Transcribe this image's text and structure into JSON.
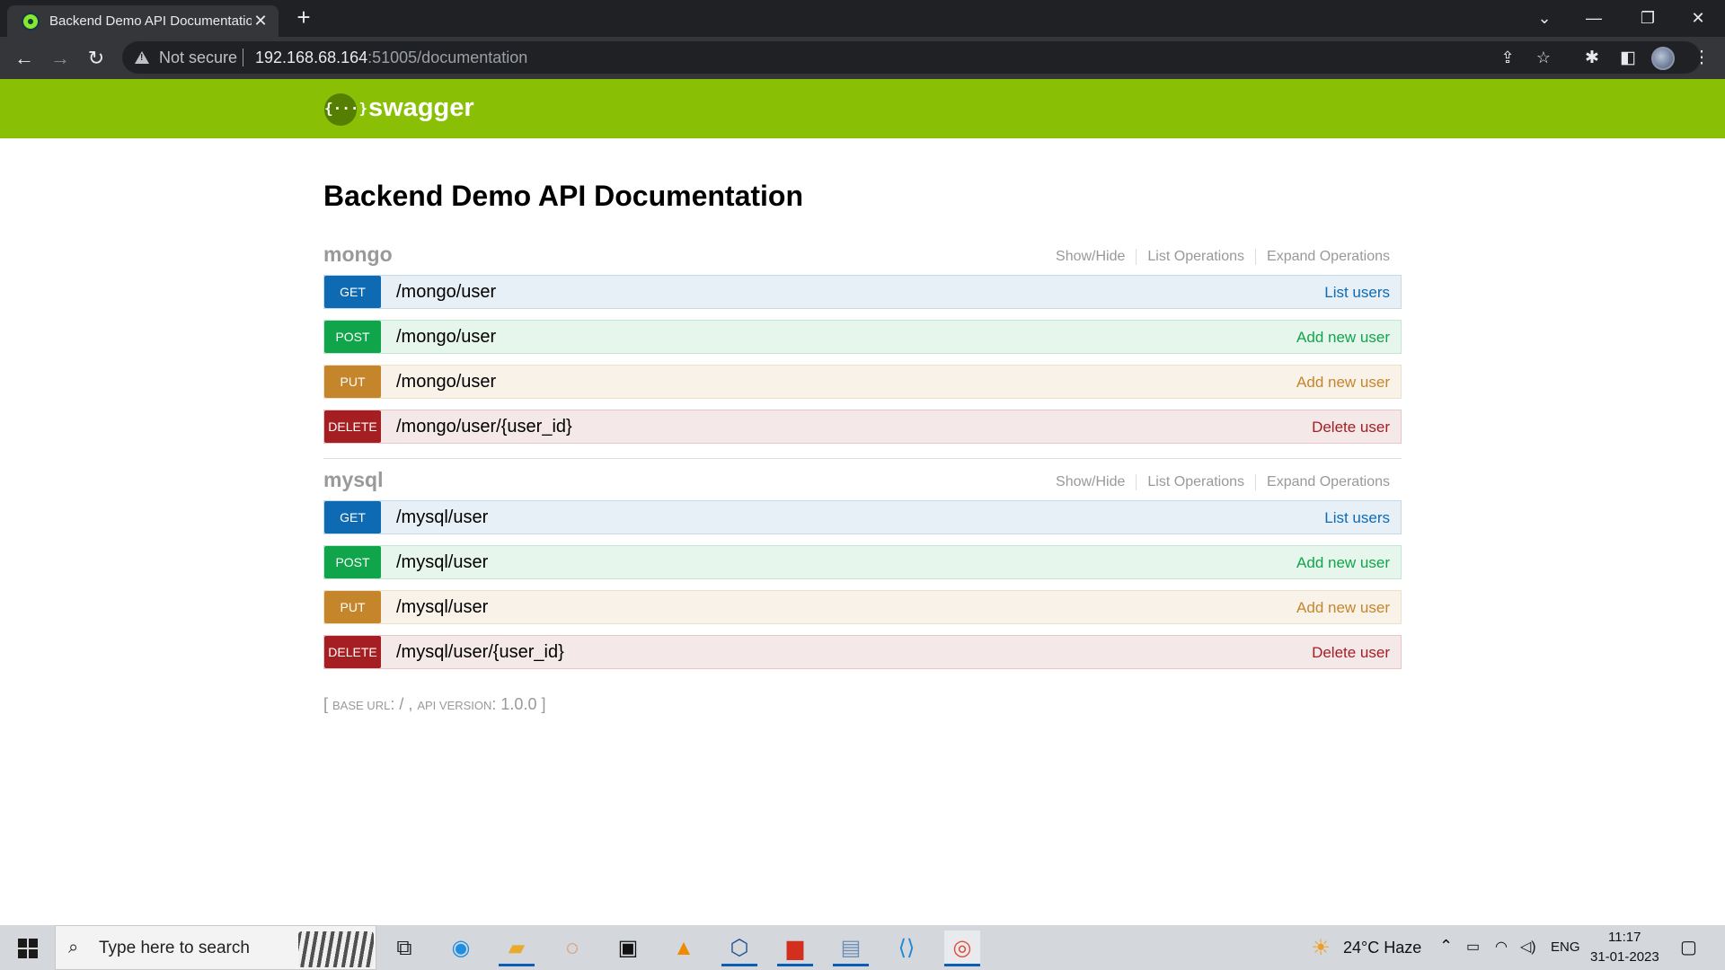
{
  "browser": {
    "tab_title": "Backend Demo API Documentation",
    "not_secure": "Not secure",
    "url_host": "192.168.68.164",
    "url_path": ":51005/documentation"
  },
  "swagger": {
    "logo_glyph": "{···}",
    "brand": "swagger",
    "header_color": "#89bf04"
  },
  "page": {
    "title": "Backend Demo API Documentation",
    "resource_actions": [
      "Show/Hide",
      "List Operations",
      "Expand Operations"
    ],
    "resources": [
      {
        "name": "mongo",
        "operations": [
          {
            "method": "GET",
            "path": "/mongo/user",
            "summary": "List users"
          },
          {
            "method": "POST",
            "path": "/mongo/user",
            "summary": "Add new user"
          },
          {
            "method": "PUT",
            "path": "/mongo/user",
            "summary": "Add new user"
          },
          {
            "method": "DELETE",
            "path": "/mongo/user/{user_id}",
            "summary": "Delete user"
          }
        ]
      },
      {
        "name": "mysql",
        "operations": [
          {
            "method": "GET",
            "path": "/mysql/user",
            "summary": "List users"
          },
          {
            "method": "POST",
            "path": "/mysql/user",
            "summary": "Add new user"
          },
          {
            "method": "PUT",
            "path": "/mysql/user",
            "summary": "Add new user"
          },
          {
            "method": "DELETE",
            "path": "/mysql/user/{user_id}",
            "summary": "Delete user"
          }
        ]
      }
    ],
    "footer": {
      "open": "[ ",
      "base_url_label": "base url",
      "base_url_value": ": / , ",
      "api_version_label": "api version",
      "api_version_value": ": 1.0.0",
      "close": " ]"
    }
  },
  "method_colors": {
    "GET": "#0f6ab4",
    "POST": "#10a54a",
    "PUT": "#c5862b",
    "DELETE": "#a41e22"
  },
  "taskbar": {
    "search_placeholder": "Type here to search",
    "weather": "24°C  Haze",
    "language": "ENG",
    "time": "11:17",
    "date": "31-01-2023"
  }
}
